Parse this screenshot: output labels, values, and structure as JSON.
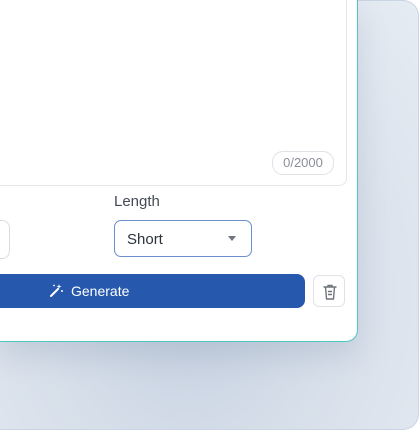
{
  "editor": {
    "char_counter": "0/2000"
  },
  "length": {
    "label": "Length",
    "selected": "Short"
  },
  "actions": {
    "generate_label": "Generate",
    "generate_icon": "magic-wand-icon",
    "delete_icon": "trash-icon"
  },
  "colors": {
    "primary": "#2659ad",
    "card_border": "#4fc7c4",
    "select_border": "#6a8fcf"
  }
}
